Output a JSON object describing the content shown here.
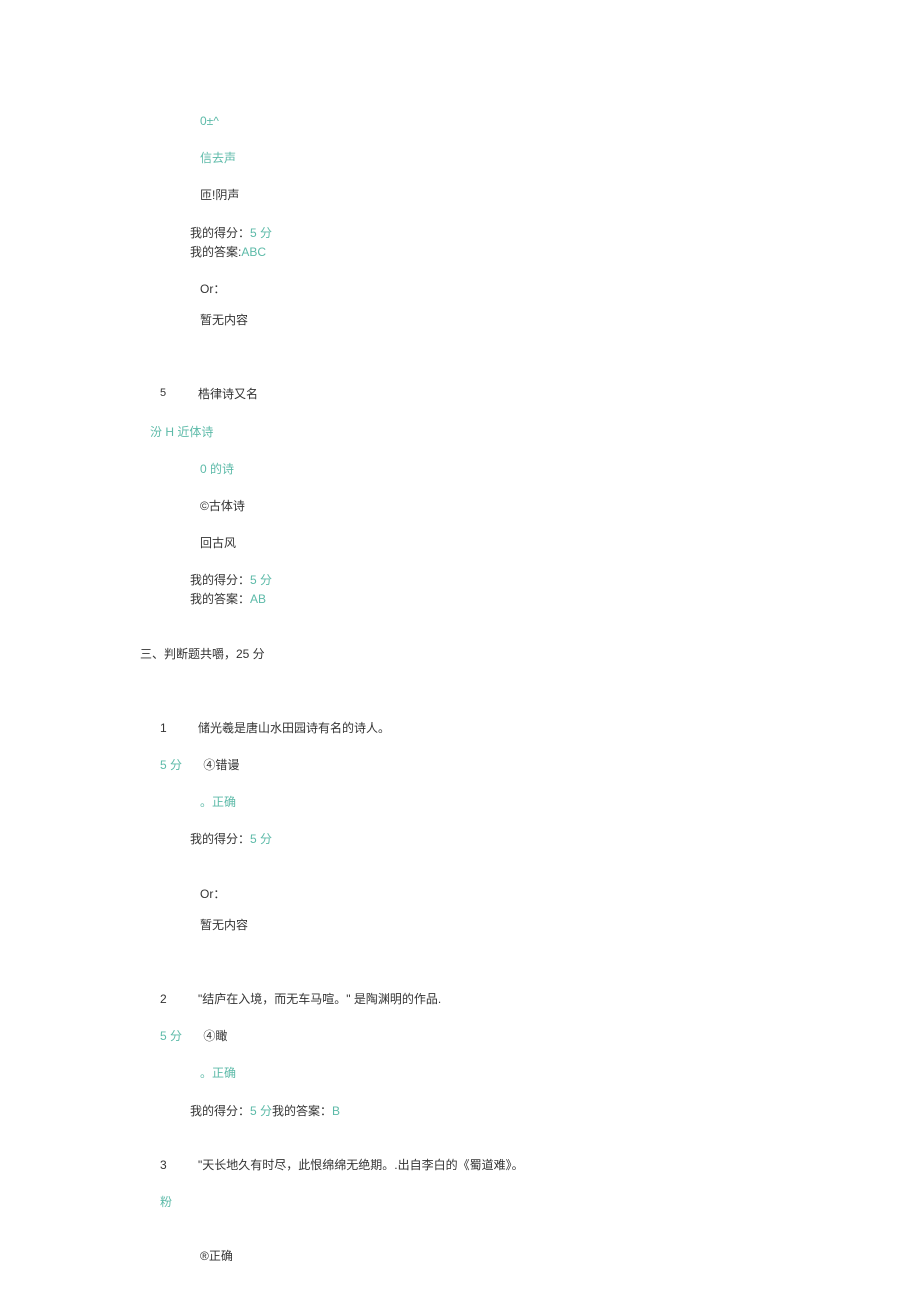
{
  "q4": {
    "opt1": "0±^",
    "opt2": "信去声",
    "opt3": "匝!阴声",
    "score_label": "我的得分：",
    "score_value": "5 分",
    "answer_label": "我的答案:",
    "answer_value": "ABC",
    "or_label": "Or：",
    "no_content": "暂无内容"
  },
  "q5": {
    "num": "5",
    "title": "梏律诗又名",
    "row2": "汾 H 近体诗",
    "opt_b": "0 的诗",
    "opt_c": "©古体诗",
    "opt_d": "回古风",
    "score_label": "我的得分：",
    "score_value": "5 分",
    "answer_label": "我的答案：",
    "answer_value": "AB"
  },
  "section3": {
    "header": "三、判断题共嚼，25 分"
  },
  "j1": {
    "num": "1",
    "title": "储光羲是唐山水田园诗有名的诗人。",
    "score": "5 分",
    "wrong": "④错谩",
    "correct": "。正确",
    "score_label": "我的得分：",
    "score_value": "5 分",
    "or_label": "Or：",
    "no_content": "暂无内容"
  },
  "j2": {
    "num": "2",
    "title": "\"结庐在入境，而无车马喧。\" 是陶渊明的作品.",
    "score": "5 分",
    "wrong": "④瞰",
    "correct": "。正确",
    "score_label": "我的得分：",
    "score_value": "5 分",
    "answer_label": "我的答案：",
    "answer_value": "B"
  },
  "j3": {
    "num": "3",
    "title": "\"天长地久有时尽，此恨绵绵无绝期。.出自李白的《蜀道难》。",
    "score": "粉",
    "correct": "®正确"
  }
}
